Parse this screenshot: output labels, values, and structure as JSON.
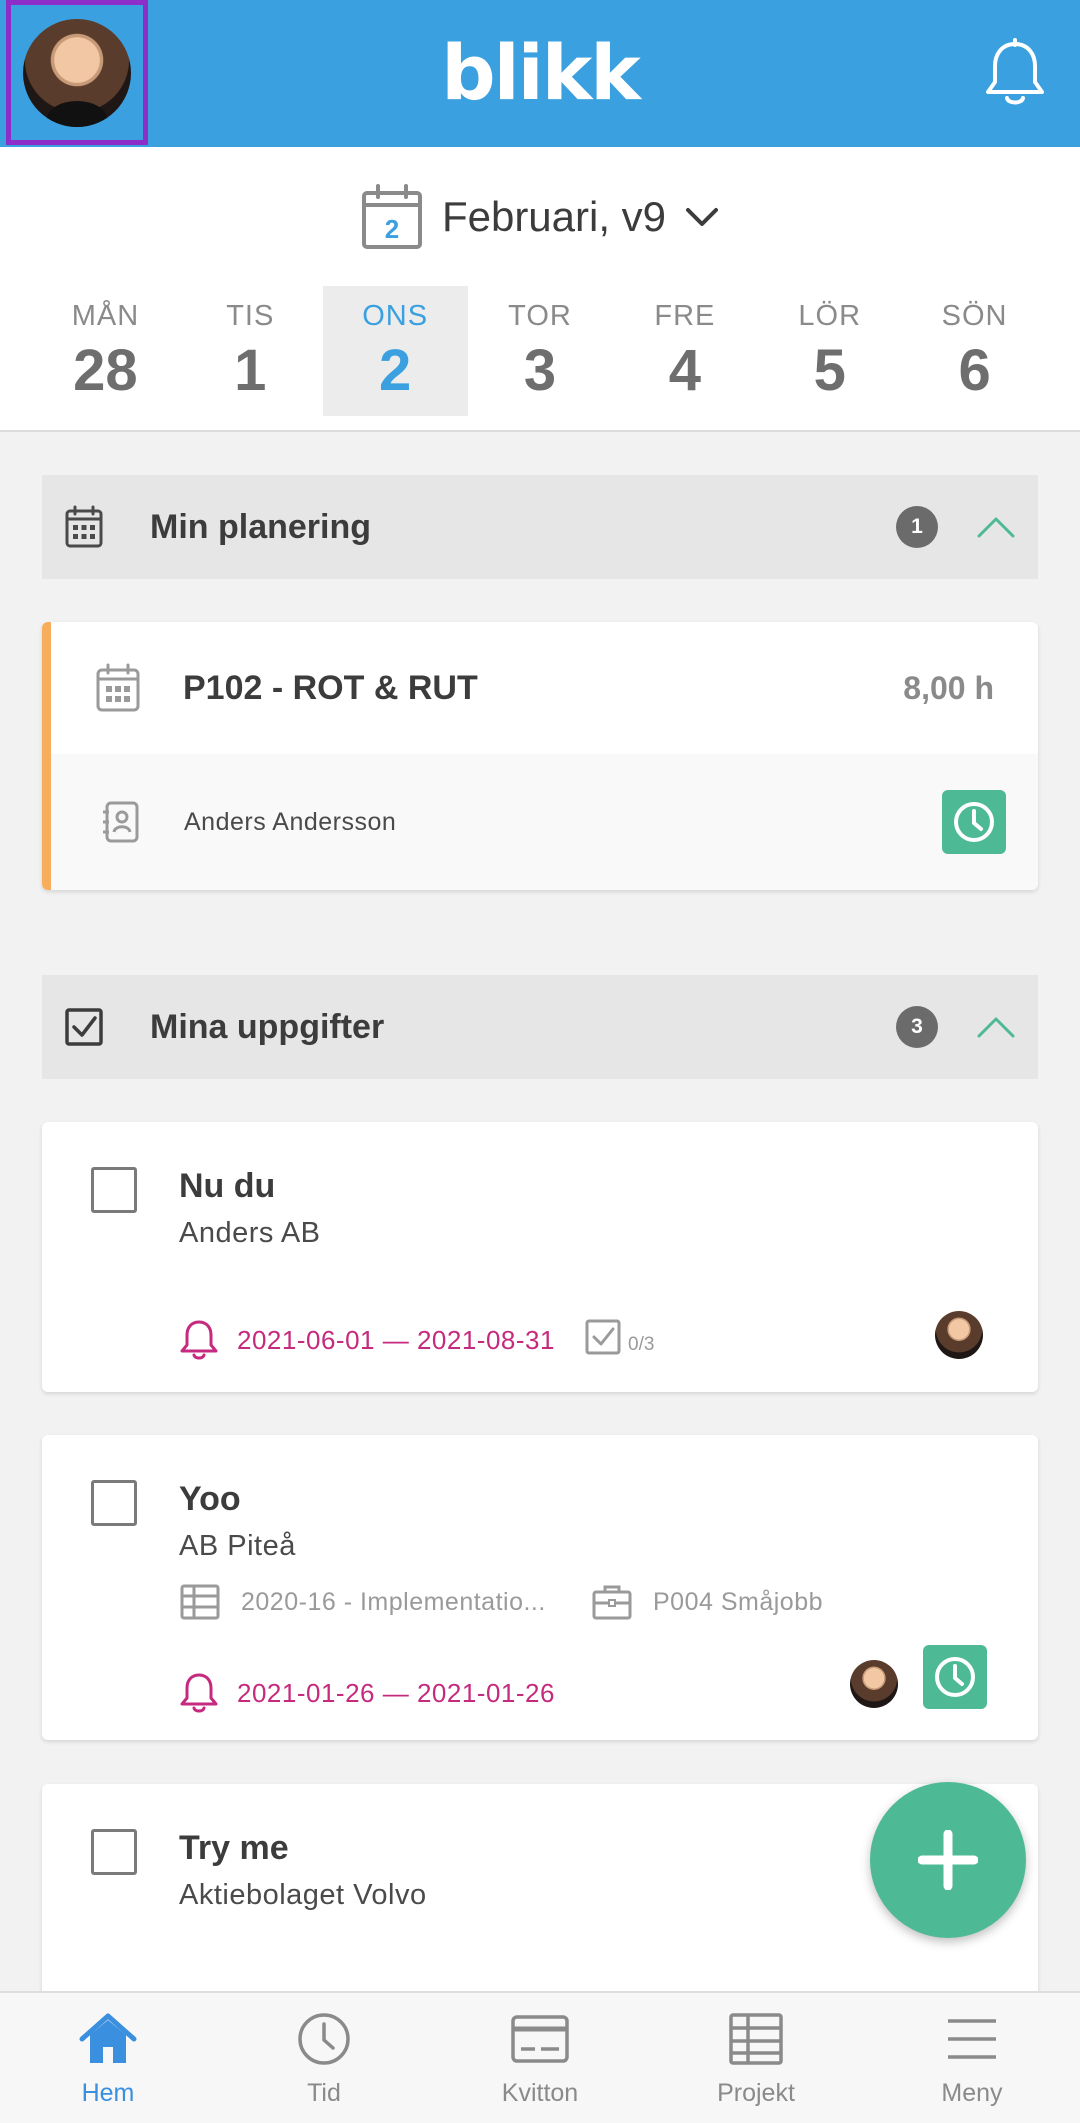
{
  "header": {
    "logo": "blikk",
    "avatar_icon": "user-avatar",
    "bell_icon": "bell-icon"
  },
  "week": {
    "calendar_day": "2",
    "title": "Februari, v9",
    "days": [
      {
        "name": "MÅN",
        "num": "28",
        "active": false
      },
      {
        "name": "TIS",
        "num": "1",
        "active": false
      },
      {
        "name": "ONS",
        "num": "2",
        "active": true
      },
      {
        "name": "TOR",
        "num": "3",
        "active": false
      },
      {
        "name": "FRE",
        "num": "4",
        "active": false
      },
      {
        "name": "LÖR",
        "num": "5",
        "active": false
      },
      {
        "name": "SÖN",
        "num": "6",
        "active": false
      }
    ]
  },
  "planning": {
    "title": "Min planering",
    "count": "1",
    "item": {
      "title": "P102 - ROT & RUT",
      "hours": "8,00 h",
      "contact": "Anders Andersson"
    }
  },
  "tasks": {
    "title": "Mina uppgifter",
    "count": "3",
    "items": [
      {
        "title": "Nu du",
        "company": "Anders AB",
        "due": "2021-06-01 — 2021-08-31",
        "checklist": "0/3"
      },
      {
        "title": "Yoo",
        "company": "AB Piteå",
        "project": "2020-16 - Implementatio...",
        "job": "P004 Småjobb",
        "due": "2021-01-26 — 2021-01-26"
      },
      {
        "title": "Try me",
        "company": "Aktiebolaget Volvo"
      }
    ]
  },
  "nav": [
    {
      "label": "Hem",
      "icon": "home-icon",
      "active": true
    },
    {
      "label": "Tid",
      "icon": "clock-icon",
      "active": false
    },
    {
      "label": "Kvitton",
      "icon": "receipt-icon",
      "active": false
    },
    {
      "label": "Projekt",
      "icon": "project-icon",
      "active": false
    },
    {
      "label": "Meny",
      "icon": "menu-icon",
      "active": false
    }
  ],
  "colors": {
    "primary": "#3aa0df",
    "accent_green": "#4dba95",
    "due_magenta": "#c62a7e",
    "plan_stripe": "#f6ad5c",
    "avatar_highlight": "#8e2ec9"
  }
}
